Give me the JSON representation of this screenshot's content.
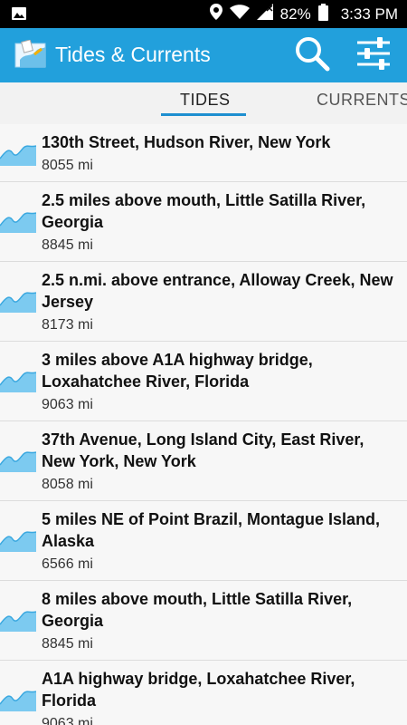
{
  "status_bar": {
    "battery_percent": "82%",
    "time": "3:33 PM",
    "icons": [
      "image-icon",
      "location-icon",
      "wifi-icon",
      "signal-icon",
      "battery-icon"
    ]
  },
  "app_bar": {
    "title": "Tides & Currents",
    "accent_color": "#22a0dc",
    "icons": [
      "app-logo-icon",
      "search-icon",
      "filter-icon"
    ]
  },
  "tabs": [
    {
      "label": "TIDES",
      "selected": true
    },
    {
      "label": "CURRENTS",
      "selected": false
    }
  ],
  "stations": [
    {
      "name": "130th Street, Hudson River, New York",
      "distance": "8055 mi"
    },
    {
      "name": "2.5 miles above mouth, Little Satilla River, Georgia",
      "distance": "8845 mi"
    },
    {
      "name": "2.5 n.mi. above entrance, Alloway Creek, New Jersey",
      "distance": "8173 mi"
    },
    {
      "name": "3 miles above A1A highway bridge, Loxahatchee River, Florida",
      "distance": "9063 mi"
    },
    {
      "name": "37th Avenue, Long Island City, East River, New York, New York",
      "distance": "8058 mi"
    },
    {
      "name": "5 miles NE of Point Brazil, Montague Island, Alaska",
      "distance": "6566 mi"
    },
    {
      "name": "8 miles above mouth, Little Satilla River, Georgia",
      "distance": "8845 mi"
    },
    {
      "name": "A1A highway bridge, Loxahatchee River, Florida",
      "distance": "9063 mi"
    }
  ]
}
